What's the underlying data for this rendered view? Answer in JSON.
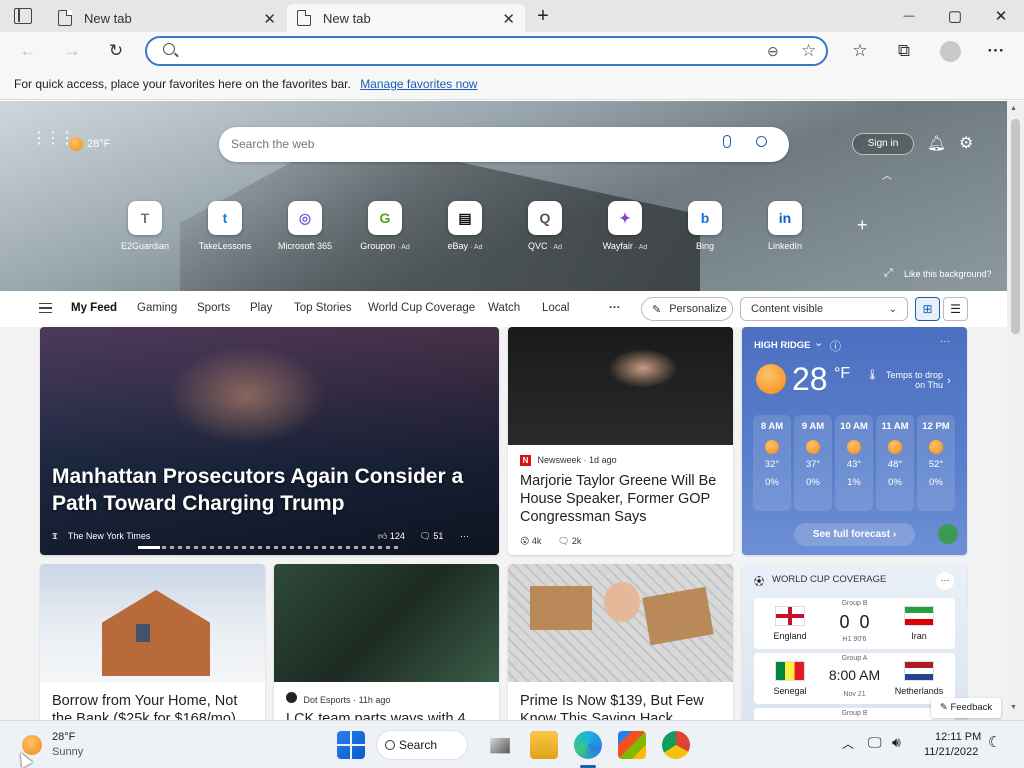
{
  "tabs": [
    {
      "label": "New tab",
      "active": false
    },
    {
      "label": "New tab",
      "active": true
    }
  ],
  "window": {
    "minimize": "—",
    "maximize": "▢",
    "close": "✕",
    "new_tab": "+"
  },
  "address": {
    "value": "",
    "placeholder": ""
  },
  "favorites_bar": {
    "text": "For quick access, place your favorites here on the favorites bar.",
    "link": "Manage favorites now"
  },
  "ntp": {
    "weather_mini": "28°F",
    "search_placeholder": "Search the web",
    "sign_in": "Sign in",
    "like_background": "Like this background?",
    "quick_links": [
      {
        "label": "E2Guardian",
        "glyph": "T",
        "ad": false
      },
      {
        "label": "TakeLessons",
        "glyph": "t",
        "ad": false
      },
      {
        "label": "Microsoft 365",
        "glyph": "◎",
        "ad": false
      },
      {
        "label": "Groupon",
        "glyph": "G",
        "ad": true
      },
      {
        "label": "eBay",
        "glyph": "▤",
        "ad": true
      },
      {
        "label": "QVC",
        "glyph": "Q",
        "ad": true
      },
      {
        "label": "Wayfair",
        "glyph": "✦",
        "ad": true
      },
      {
        "label": "Bing",
        "glyph": "b",
        "ad": false
      },
      {
        "label": "LinkedIn",
        "glyph": "in",
        "ad": false
      }
    ],
    "ad_label": "· Ad",
    "feed_nav": [
      "My Feed",
      "Gaming",
      "Sports",
      "Play",
      "Top Stories",
      "World Cup Coverage",
      "Watch",
      "Local"
    ],
    "more": "···",
    "personalize": "Personalize",
    "content_visible": "Content visible"
  },
  "cards": {
    "main": {
      "headline": "Manhattan Prosecutors Again Consider a Path Toward Charging Trump",
      "source": "The New York Times",
      "reactions": "124",
      "comments": "51"
    },
    "second": {
      "source": "Newsweek",
      "age": "1d ago",
      "headline": "Marjorie Taylor Greene Will Be House Speaker, Former GOP Congressman Says",
      "reactions": "4k",
      "comments": "2k"
    },
    "weather": {
      "location": "HIGH RIDGE",
      "temp": "28",
      "unit": "°F",
      "note": "Temps to drop on Thu",
      "hours": [
        {
          "time": "8 AM",
          "temp": "32°",
          "precip": "0%"
        },
        {
          "time": "9 AM",
          "temp": "37°",
          "precip": "0%"
        },
        {
          "time": "10 AM",
          "temp": "43°",
          "precip": "1%"
        },
        {
          "time": "11 AM",
          "temp": "48°",
          "precip": "0%"
        },
        {
          "time": "12 PM",
          "temp": "52°",
          "precip": "0%"
        }
      ],
      "forecast_button": "See full forecast"
    },
    "house": {
      "headline": "Borrow from Your Home, Not the Bank ($25k for $168/mo)"
    },
    "esports": {
      "source": "Dot Esports",
      "age": "11h ago",
      "headline": "LCK team parts ways with 4"
    },
    "prime": {
      "headline": "Prime Is Now $139, But Few Know This Saving Hack"
    },
    "worldcup": {
      "title": "WORLD CUP COVERAGE",
      "matches": [
        {
          "group": "Group B",
          "home": "England",
          "away": "Iran",
          "score": "0  0",
          "status": "H1 90'6"
        },
        {
          "group": "Group A",
          "home": "Senegal",
          "away": "Netherlands",
          "score": "8:00 AM",
          "status": "Nov 21"
        },
        {
          "group": "Group B",
          "home": "",
          "away": "",
          "score": "",
          "status": ""
        }
      ]
    },
    "feedback": "Feedback"
  },
  "taskbar": {
    "weather_temp": "28°F",
    "weather_desc": "Sunny",
    "search": "Search",
    "time": "12:11 PM",
    "date": "11/21/2022"
  }
}
